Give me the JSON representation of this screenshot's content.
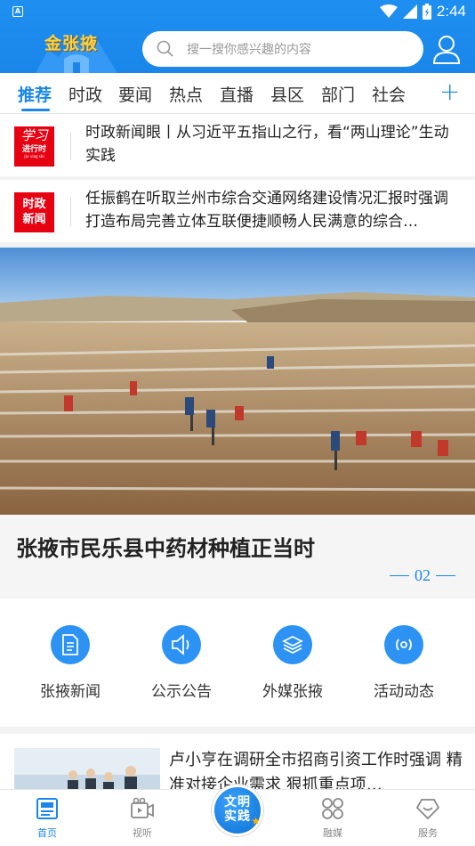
{
  "status_bar": {
    "time": "2:44",
    "app_badge": "A"
  },
  "header": {
    "logo_text": "金张掖",
    "search_placeholder": "搜一搜你感兴趣的内容"
  },
  "tabs": [
    {
      "label": "推荐",
      "active": true
    },
    {
      "label": "时政"
    },
    {
      "label": "要闻"
    },
    {
      "label": "热点"
    },
    {
      "label": "直播"
    },
    {
      "label": "县区"
    },
    {
      "label": "部门"
    },
    {
      "label": "社会"
    }
  ],
  "headlines": [
    {
      "badge_line1": "学习",
      "badge_line2": "进行时",
      "badge_line3": "jin xing shi",
      "title": "时政新闻眼丨从习近平五指山之行，看“两山理论”生动实践"
    },
    {
      "badge_line1": "时政",
      "badge_line2": "新闻",
      "title": "任振鹤在听取兰州市综合交通网络建设情况汇报时强调 打造布局完善立体互联便捷顺畅人民满意的综合…"
    }
  ],
  "banner": {
    "title": "张掖市民乐县中药材种植正当时",
    "index": "02"
  },
  "quick_entries": [
    {
      "label": "张掖新闻",
      "icon": "document-icon"
    },
    {
      "label": "公示公告",
      "icon": "speaker-icon"
    },
    {
      "label": "外媒张掖",
      "icon": "layers-icon"
    },
    {
      "label": "活动动态",
      "icon": "broadcast-icon"
    }
  ],
  "article": {
    "title": "卢小亨在调研全市招商引资工作时强调 精准对接企业需求 狠抓重点项…"
  },
  "bottom_nav": {
    "items": [
      {
        "label": "首页",
        "icon": "home-icon",
        "active": true
      },
      {
        "label": "视听",
        "icon": "video-icon"
      },
      {
        "label": "融媒",
        "icon": "grid-icon"
      },
      {
        "label": "服务",
        "icon": "service-icon"
      }
    ],
    "center_line1": "文明",
    "center_line2": "实践"
  },
  "colors": {
    "brand_blue": "#1a86ea",
    "badge_red": "#e60012",
    "icon_circle": "#2c93f4"
  }
}
